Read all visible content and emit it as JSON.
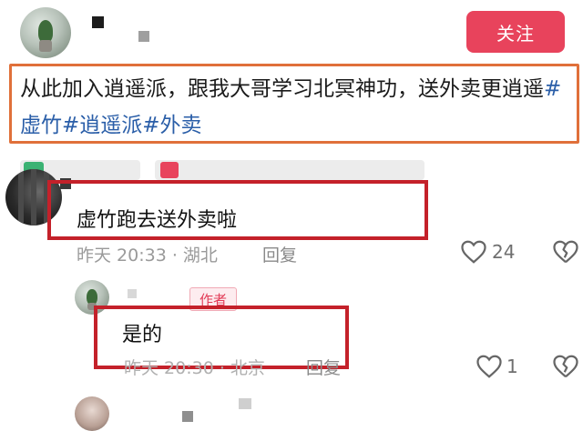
{
  "header": {
    "follow_label": "关注"
  },
  "post": {
    "caption_plain": "从此加入逍遥派，跟我大哥学习北冥神功，送外卖更逍遥",
    "tags": [
      "#虚竹",
      "#逍遥派",
      "#外卖"
    ]
  },
  "comments": [
    {
      "text": "虚竹跑去送外卖啦",
      "time_location": "昨天 20:33 · 湖北",
      "reply_label": "回复",
      "likes": "24"
    },
    {
      "author_badge": "作者",
      "text": "是的",
      "time_location": "昨天 20:30 · 北京",
      "reply_label": "回复",
      "likes": "1"
    }
  ],
  "colors": {
    "follow_button": "#e8435c",
    "caption_highlight": "#e0703a",
    "comment_highlight": "#c4212a",
    "hashtag": "#2a5ea8"
  }
}
